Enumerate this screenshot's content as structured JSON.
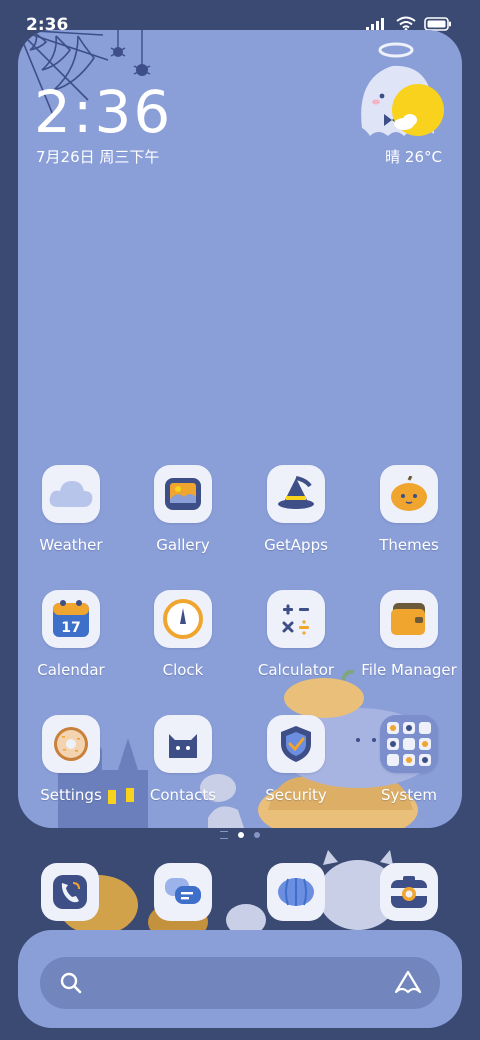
{
  "status_bar": {
    "time": "2:36",
    "icons": [
      "signal-icon",
      "wifi-icon",
      "battery-icon"
    ]
  },
  "widget": {
    "time": "2:36",
    "date": "7月26日 周三下午",
    "weather": "晴 26°C"
  },
  "apps": [
    {
      "label": "Weather",
      "icon": "cloud-icon"
    },
    {
      "label": "Gallery",
      "icon": "picture-icon"
    },
    {
      "label": "GetApps",
      "icon": "witch-hat-icon"
    },
    {
      "label": "Themes",
      "icon": "pumpkin-icon"
    },
    {
      "label": "Calendar",
      "icon": "calendar-icon",
      "day": "17"
    },
    {
      "label": "Clock",
      "icon": "clock-icon"
    },
    {
      "label": "Calculator",
      "icon": "calculator-icon"
    },
    {
      "label": "File Manager",
      "icon": "folder-icon"
    },
    {
      "label": "Settings",
      "icon": "donut-icon"
    },
    {
      "label": "Contacts",
      "icon": "cat-icon"
    },
    {
      "label": "Security",
      "icon": "shield-icon"
    },
    {
      "label": "System",
      "icon": "folder-grid-icon"
    }
  ],
  "page_indicator": {
    "pages": 2,
    "current": 1
  },
  "dock": [
    {
      "icon": "phone-icon"
    },
    {
      "icon": "messages-icon"
    },
    {
      "icon": "browser-icon"
    },
    {
      "icon": "camera-icon"
    }
  ],
  "search": {
    "icons": [
      "search-icon",
      "assistant-icon"
    ]
  },
  "colors": {
    "background": "#3b4a73",
    "panel": "#8a9ed8",
    "icon_bg": "#eef1fa",
    "accent_navy": "#3e4f87",
    "accent_orange": "#f0a52e",
    "sun": "#f8d21c"
  }
}
